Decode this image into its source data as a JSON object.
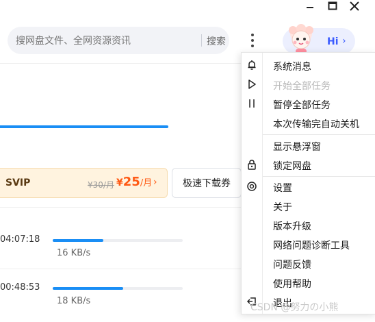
{
  "window": {
    "minimize_icon": "minimize-icon",
    "maximize_icon": "maximize-icon",
    "close_icon": "close-icon"
  },
  "search": {
    "placeholder": "搜网盘文件、全网资源资讯",
    "button_label": "搜索"
  },
  "user": {
    "greeting": "Hi",
    "avatar_icon": "cartoon-avatar-icon"
  },
  "promo": {
    "svip_label": "SVIP",
    "old_price": "¥30/月",
    "new_price_symbol": "¥",
    "new_price": "25",
    "new_price_unit": "/月",
    "coupon_button": "极速下载券"
  },
  "transfers": [
    {
      "time": "04:07:18",
      "speed": "16 KB/s",
      "progress": 0.39
    },
    {
      "time": "00:48:53",
      "speed": "18 KB/s",
      "progress": 0.54
    }
  ],
  "menu": {
    "items": [
      {
        "label": "系统消息",
        "icon": "bell-icon",
        "enabled": true
      },
      {
        "label": "开始全部任务",
        "icon": "play-icon",
        "enabled": false
      },
      {
        "label": "暂停全部任务",
        "icon": "pause-icon",
        "enabled": true
      },
      {
        "label": "本次传输完自动关机",
        "icon": "",
        "enabled": true
      },
      {
        "label": "显示悬浮窗",
        "icon": "",
        "enabled": true
      },
      {
        "label": "锁定网盘",
        "icon": "lock-icon",
        "enabled": true
      },
      {
        "label": "设置",
        "icon": "settings-icon",
        "enabled": true
      },
      {
        "label": "关于",
        "icon": "",
        "enabled": true
      },
      {
        "label": "版本升级",
        "icon": "",
        "enabled": true
      },
      {
        "label": "网络问题诊断工具",
        "icon": "",
        "enabled": true
      },
      {
        "label": "问题反馈",
        "icon": "",
        "enabled": true
      },
      {
        "label": "使用帮助",
        "icon": "",
        "enabled": true
      },
      {
        "label": "退出",
        "icon": "exit-icon",
        "enabled": true
      }
    ]
  },
  "watermark": "CSDN @努力の小熊",
  "colors": {
    "accent": "#1a8ef5",
    "price": "#ff5a14",
    "hi": "#3b5bff"
  }
}
